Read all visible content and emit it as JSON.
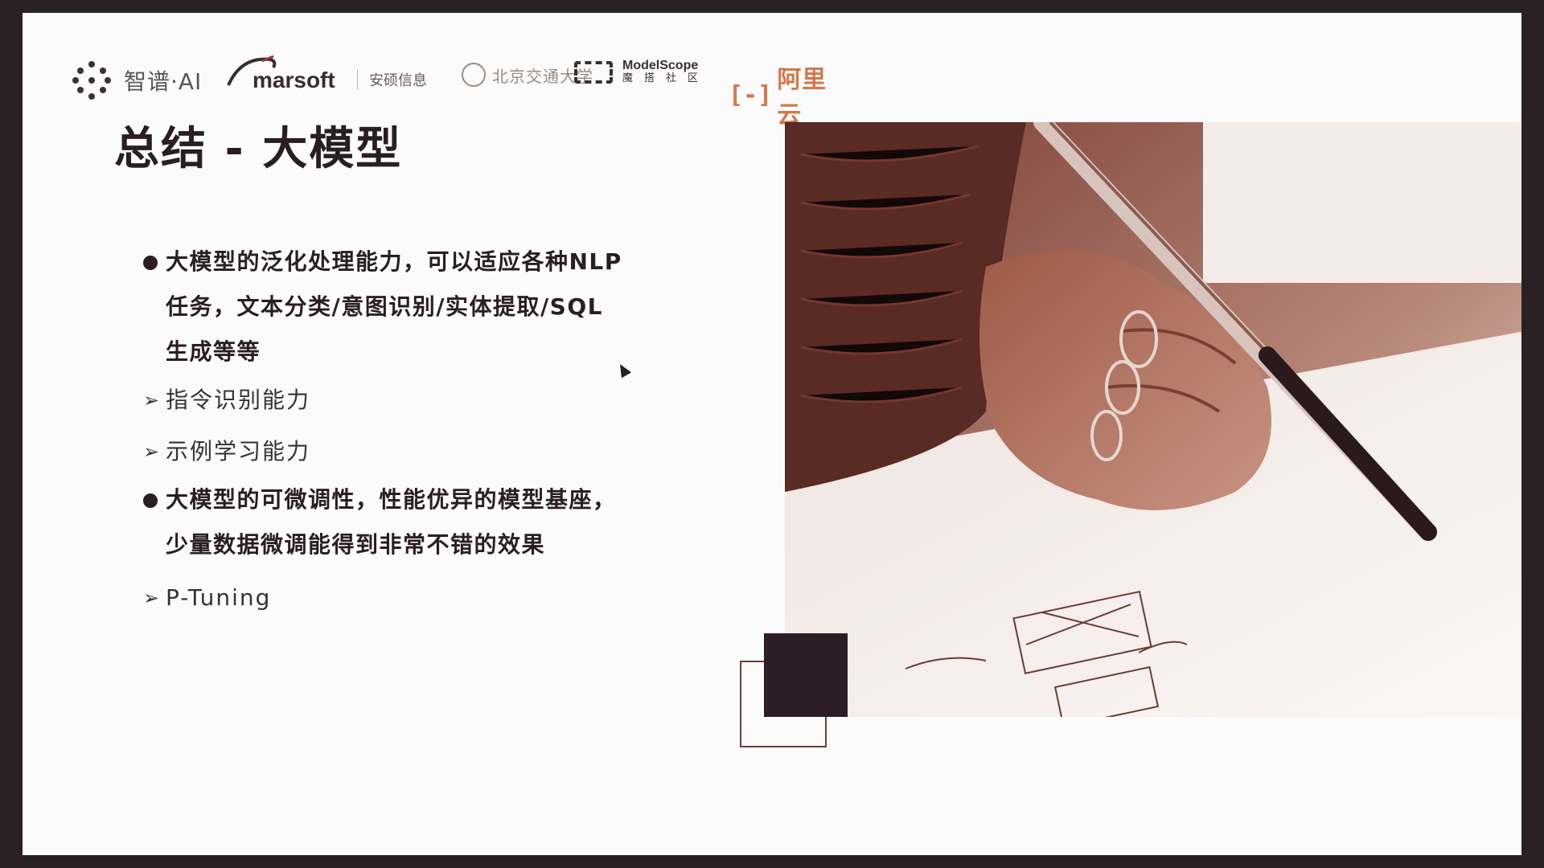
{
  "logos": {
    "zhipu": "智谱·AI",
    "marsoft": "marsoft",
    "anshuo": "安硕信息",
    "university": "北京交通大学",
    "modelscope_en": "ModelScope",
    "modelscope_cn": "魔搭社区",
    "aliyun_bracket": "[-]",
    "aliyun": "阿里云"
  },
  "title": "总结 - 大模型",
  "content": {
    "bullet1": [
      "大模型的泛化处理能力，可以适应各种NLP",
      "任务，文本分类/意图识别/实体提取/SQL",
      "生成等等"
    ],
    "sub1": "指令识别能力",
    "sub2": "示例学习能力",
    "bullet2": [
      "大模型的可微调性，性能优异的模型基座，",
      "少量数据微调能得到非常不错的效果"
    ],
    "sub3": "P-Tuning",
    "arrow_icon": "➢"
  },
  "colors": {
    "frame": "#2b2124",
    "slide_bg": "#fbfbfb",
    "title": "#2a1e22",
    "accent_dark": "#2c1d26",
    "accent_outline": "#6f3a38",
    "photo_tone": "#a0614b",
    "aliyun_orange": "#d0794f"
  }
}
